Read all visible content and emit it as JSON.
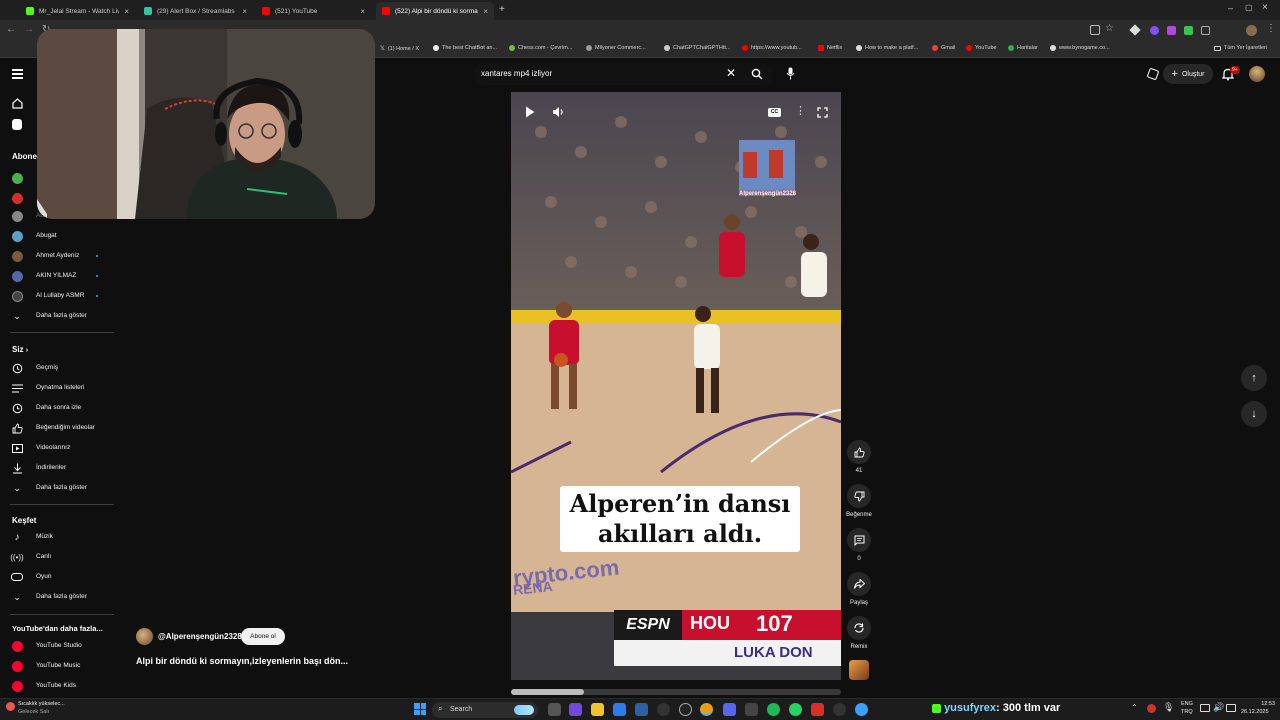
{
  "browser": {
    "tabs": [
      {
        "label": "Mr_Jelal Stream - Watch Live o",
        "color": "#53fc18"
      },
      {
        "label": "(29) Alert Box / Streamlabs",
        "color": "#31c3a2"
      },
      {
        "label": "(521) YouTube",
        "color": "#ff0000"
      },
      {
        "label": "(522) Alpi bir döndü ki sormay",
        "color": "#ff0000"
      }
    ],
    "new_tab": "+",
    "bookmarks": [
      "(1) Home / X",
      "The best ChatBot an...",
      "Chess.com - Çevrim...",
      "Milyoner Commerc...",
      "ChatGPTChatGPTHtt...",
      "https://www.youtub...",
      "Netflix",
      "How to make a platf...",
      "Gmail",
      "YouTube",
      "Haritalar",
      "www.bynogame.co..."
    ],
    "all_bookmarks": "Tüm Yer İşaretleri"
  },
  "masthead": {
    "search_value": "xantares mp4 izliyor",
    "create_label": "Oluştur",
    "notif_count": "9+"
  },
  "sidebar": {
    "subs_title": "Aboneli",
    "subs": [
      {
        "label": "Abnormal",
        "color": "#888888"
      },
      {
        "label": "Abugat",
        "color": "#5aa0c8"
      },
      {
        "label": "Ahmet Aydeniz",
        "color": "#7a5a3a"
      },
      {
        "label": "AKIN YILMAZ",
        "color": "#5566aa"
      },
      {
        "label": "Al Lullaby ASMR",
        "color": "#444444"
      }
    ],
    "subs_more": "Daha fazla göster",
    "you_title": "Siz",
    "you_items": [
      {
        "label": "Geçmiş",
        "icon": "history-icon"
      },
      {
        "label": "Oynatma listeleri",
        "icon": "playlist-icon"
      },
      {
        "label": "Daha sonra izle",
        "icon": "clock-icon"
      },
      {
        "label": "Beğendiğim videolar",
        "icon": "thumbs-up-icon"
      },
      {
        "label": "Videolarınız",
        "icon": "video-icon"
      },
      {
        "label": "İndirilenler",
        "icon": "download-icon"
      },
      {
        "label": "Daha fazla göster",
        "icon": "chevron-down-icon"
      }
    ],
    "explore_title": "Keşfet",
    "explore_items": [
      {
        "label": "Müzik",
        "icon": "music-icon"
      },
      {
        "label": "Canlı",
        "icon": "live-icon"
      },
      {
        "label": "Oyun",
        "icon": "game-icon"
      },
      {
        "label": "Daha fazla göster",
        "icon": "chevron-down-icon"
      }
    ],
    "more_title": "YouTube'dan daha fazla...",
    "more_items": [
      "YouTube Studio",
      "YouTube Music",
      "YouTube Kids"
    ]
  },
  "video": {
    "watermark": "Alperenşengün2328",
    "caption_line1": "Alperen’in dansı",
    "caption_line2": "akılları aldı.",
    "arena_text": "rypto.com",
    "arena_text2": "RENA",
    "score_network": "ESPN",
    "score_team": "HOU",
    "score_value": "107",
    "score_player": "LUKA DON",
    "progress": 0.22
  },
  "actions": {
    "likes": "41",
    "dislike_label": "Beğenme",
    "comments": "0",
    "share_label": "Paylaş",
    "remix_label": "Remix"
  },
  "channel": {
    "name": "@Alperenşengün2328",
    "subscribe_label": "Abone ol",
    "title": "Alpi bir döndü ki sormayın,izleyenlerin başı dön..."
  },
  "taskbar": {
    "weather_line1": "Sıcaklık yükselec...",
    "weather_line2": "Gelecek Salı",
    "search_label": "Search",
    "lang_line1": "ENG",
    "lang_line2": "TRQ",
    "time": "12:53",
    "date": "26.12.2025"
  },
  "overlay": {
    "user": "yusufyrex",
    "message": ": 300 tlm var"
  }
}
